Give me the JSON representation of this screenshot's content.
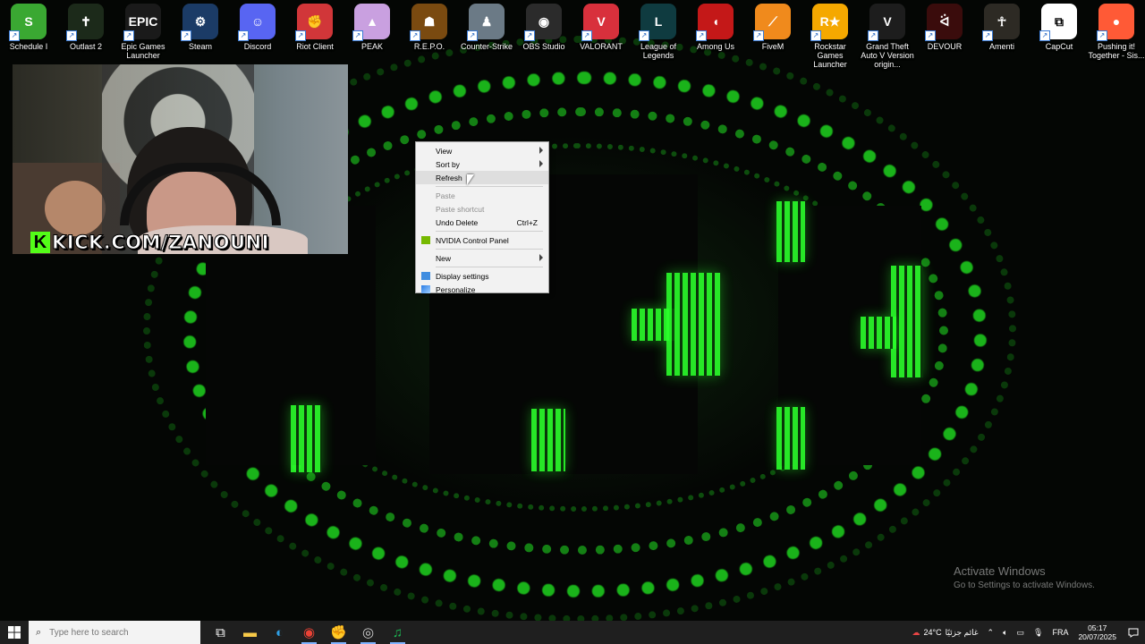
{
  "desktop": {
    "icons": [
      {
        "label": "Schedule I",
        "color": "#3aa832",
        "glyph": "S"
      },
      {
        "label": "Outlast 2",
        "color": "#1c2a1a",
        "glyph": "✝"
      },
      {
        "label": "Epic Games Launcher",
        "color": "#1a1a1a",
        "glyph": "EPIC"
      },
      {
        "label": "Steam",
        "color": "#1b3b66",
        "glyph": "⚙"
      },
      {
        "label": "Discord",
        "color": "#5865f2",
        "glyph": "☺"
      },
      {
        "label": "Riot Client",
        "color": "#d13639",
        "glyph": "✊"
      },
      {
        "label": "PEAK",
        "color": "#c9a0e0",
        "glyph": "▲"
      },
      {
        "label": "R.E.P.O.",
        "color": "#7a4a10",
        "glyph": "☗"
      },
      {
        "label": "Counter-Strike",
        "color": "#6b7a86",
        "glyph": "♟"
      },
      {
        "label": "OBS Studio",
        "color": "#2b2b2b",
        "glyph": "◉"
      },
      {
        "label": "VALORANT",
        "color": "#d8303c",
        "glyph": "V"
      },
      {
        "label": "League of Legends",
        "color": "#0f3b40",
        "glyph": "L"
      },
      {
        "label": "Among Us",
        "color": "#c41818",
        "glyph": "◖"
      },
      {
        "label": "FiveM",
        "color": "#f08a1c",
        "glyph": "⟋"
      },
      {
        "label": "Rockstar Games Launcher",
        "color": "#f5a800",
        "glyph": "R★"
      },
      {
        "label": "Grand Theft Auto V Version origin...",
        "color": "#1d1d1d",
        "glyph": "V"
      },
      {
        "label": "DEVOUR",
        "color": "#3a0c0c",
        "glyph": "ᐛ"
      },
      {
        "label": "Amenti",
        "color": "#2d2a24",
        "glyph": "☥"
      },
      {
        "label": "CapCut",
        "color": "#ffffff",
        "glyph": "⧉"
      },
      {
        "label": "Pushing it! Together - Sis...",
        "color": "#ff5a36",
        "glyph": "●"
      }
    ]
  },
  "webcam": {
    "banner_text": "KICK.COM/ZANOUNI",
    "logo_letter": "K",
    "brand_color": "#53fc18"
  },
  "context_menu": {
    "items": [
      {
        "label": "View",
        "submenu": true,
        "state": "normal"
      },
      {
        "label": "Sort by",
        "submenu": true,
        "state": "normal"
      },
      {
        "label": "Refresh",
        "submenu": false,
        "state": "hover"
      },
      {
        "separator": true
      },
      {
        "label": "Paste",
        "submenu": false,
        "state": "disabled"
      },
      {
        "label": "Paste shortcut",
        "submenu": false,
        "state": "disabled"
      },
      {
        "label": "Undo Delete",
        "submenu": false,
        "state": "normal",
        "shortcut": "Ctrl+Z"
      },
      {
        "separator": true
      },
      {
        "label": "NVIDIA Control Panel",
        "submenu": false,
        "state": "normal",
        "icon": "nvidia-icon"
      },
      {
        "separator": true
      },
      {
        "label": "New",
        "submenu": true,
        "state": "normal"
      },
      {
        "separator": true
      },
      {
        "label": "Display settings",
        "submenu": false,
        "state": "normal",
        "icon": "display-icon"
      },
      {
        "label": "Personalize",
        "submenu": false,
        "state": "normal",
        "icon": "personalize-icon"
      }
    ]
  },
  "watermark": {
    "title": "Activate Windows",
    "subtitle": "Go to Settings to activate Windows."
  },
  "taskbar": {
    "search_placeholder": "Type here to search",
    "apps": [
      {
        "name": "task-view-icon",
        "glyph": "⧉",
        "color": "#ffffff"
      },
      {
        "name": "file-explorer-icon",
        "glyph": "▬",
        "color": "#f7c948"
      },
      {
        "name": "edge-icon",
        "glyph": "◐",
        "color": "#2fa0e6"
      },
      {
        "name": "chrome-icon",
        "glyph": "◉",
        "color": "#e94235"
      },
      {
        "name": "riot-icon",
        "glyph": "✊",
        "color": "#d13639"
      },
      {
        "name": "obs-icon",
        "glyph": "◎",
        "color": "#cfcfcf"
      },
      {
        "name": "spotify-icon",
        "glyph": "♫",
        "color": "#1db954"
      }
    ],
    "tray": {
      "weather": "24°C",
      "weather_text": "غائم جزئيًا",
      "language": "FRA",
      "time": "05:17",
      "date": "20/07/2025"
    }
  }
}
